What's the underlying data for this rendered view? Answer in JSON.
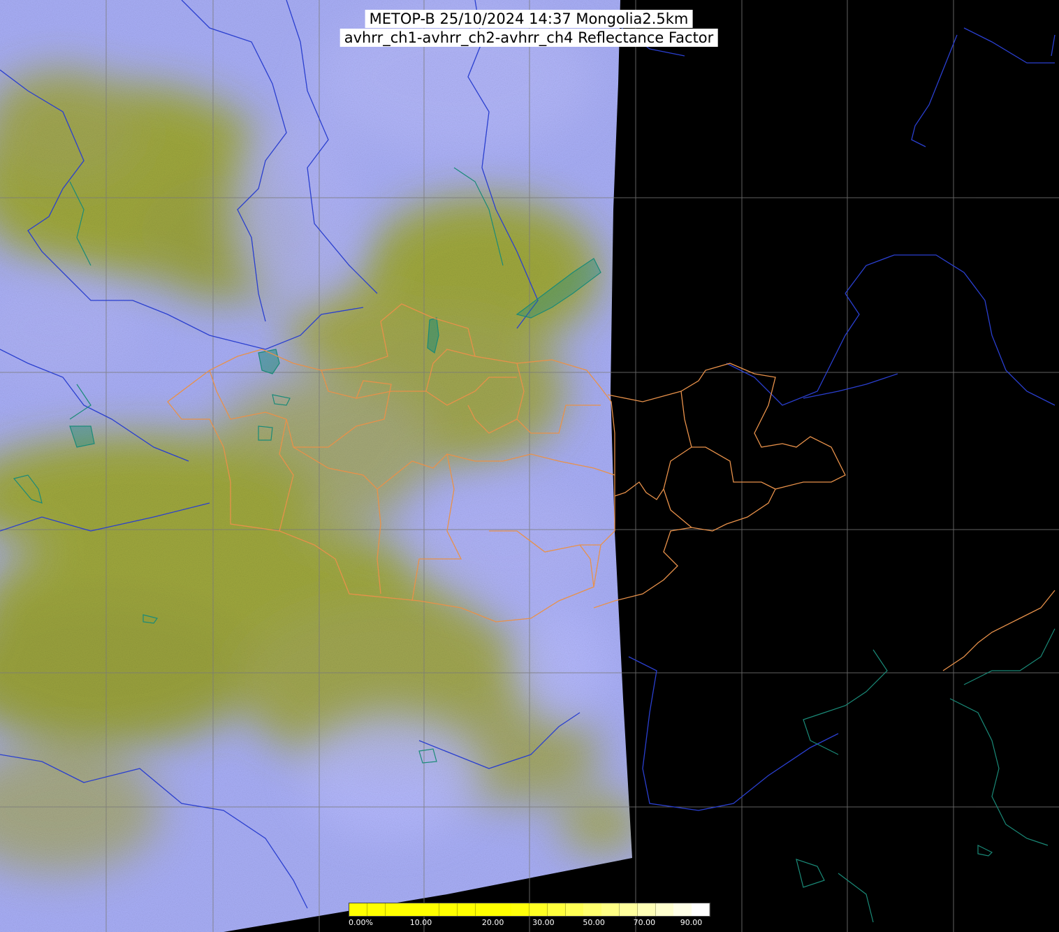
{
  "title": {
    "line1": "METOP-B 25/10/2024 14:37 Mongolia2.5km",
    "line2": "avhrr_ch1-avhrr_ch2-avhrr_ch4 Reflectance Factor"
  },
  "legend": {
    "ticks": [
      {
        "label": "0.00%",
        "value": 0
      },
      {
        "label": "10.00",
        "value": 10
      },
      {
        "label": "20.00",
        "value": 20
      },
      {
        "label": "30.00",
        "value": 30
      },
      {
        "label": "50.00",
        "value": 50
      },
      {
        "label": "70.00",
        "value": 70
      },
      {
        "label": "90.00",
        "value": 90
      }
    ],
    "min": 0,
    "max": 100
  },
  "colors": {
    "cloud": "#a8aef6",
    "land": "#9ea72c",
    "background": "#000000",
    "grid": "#7a7a7a",
    "coastline": "#2a3fcf",
    "border": "#e8914a",
    "lakes": "#1a8a78",
    "legend_low": "#ffff00",
    "legend_high": "#ffffff"
  },
  "layers": [
    "satellite-imagery",
    "lat-lon-grid",
    "coastlines",
    "province-borders",
    "lakes-rivers"
  ]
}
